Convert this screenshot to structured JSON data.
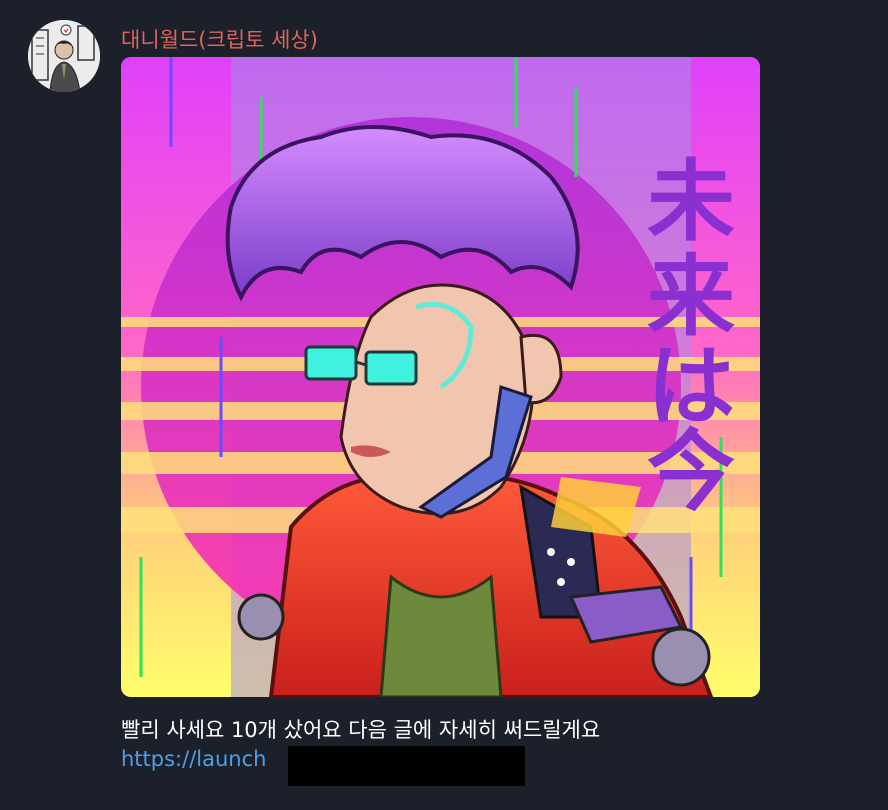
{
  "message": {
    "sender_name": "대니월드(크립토 세상)",
    "caption": "빨리 사세요 10개 샀어요 다음 글에 자세히 써드릴게요",
    "link_text": "https://launch",
    "image_text": "未来は今"
  },
  "colors": {
    "background": "#1b202a",
    "sender_name": "#e0645b",
    "link": "#4ea0e6",
    "caption": "#ffffff"
  }
}
